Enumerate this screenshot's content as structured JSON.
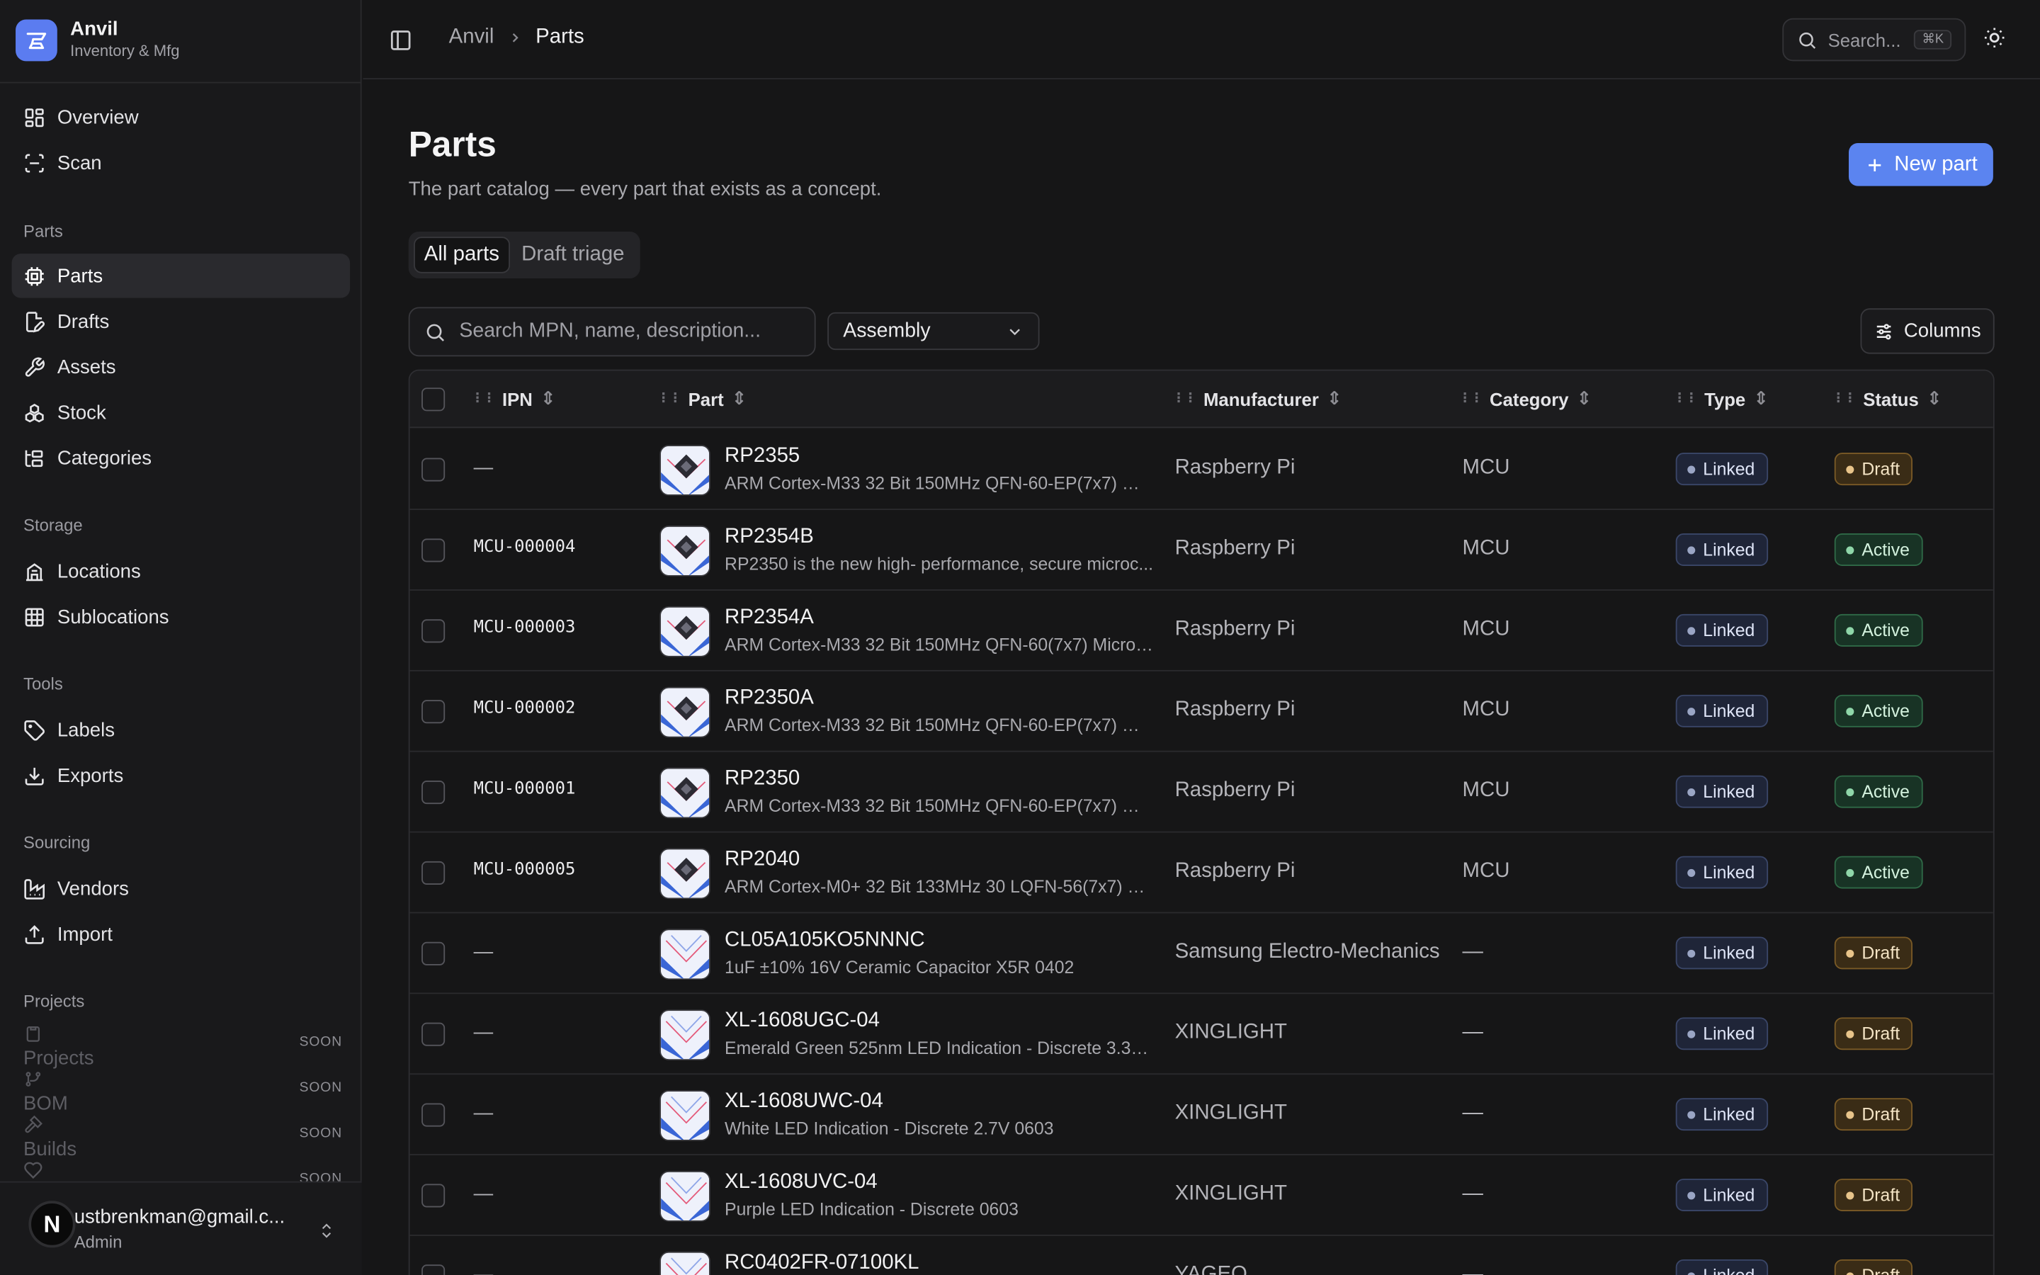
{
  "brand": {
    "name": "Anvil",
    "subtitle": "Inventory & Mfg"
  },
  "sidebar": {
    "top_items": [
      {
        "label": "Overview",
        "icon": "grid-icon"
      },
      {
        "label": "Scan",
        "icon": "scan-icon"
      }
    ],
    "sections": [
      {
        "title": "Parts",
        "items": [
          {
            "label": "Parts",
            "icon": "chip-icon",
            "active": true
          },
          {
            "label": "Drafts",
            "icon": "file-edit-icon"
          },
          {
            "label": "Assets",
            "icon": "wrench-icon"
          },
          {
            "label": "Stock",
            "icon": "boxes-icon"
          },
          {
            "label": "Categories",
            "icon": "tree-icon"
          }
        ]
      },
      {
        "title": "Storage",
        "items": [
          {
            "label": "Locations",
            "icon": "building-icon"
          },
          {
            "label": "Sublocations",
            "icon": "table-grid-icon"
          }
        ]
      },
      {
        "title": "Tools",
        "items": [
          {
            "label": "Labels",
            "icon": "tag-icon"
          },
          {
            "label": "Exports",
            "icon": "download-icon"
          }
        ]
      },
      {
        "title": "Sourcing",
        "items": [
          {
            "label": "Vendors",
            "icon": "factory-icon"
          },
          {
            "label": "Import",
            "icon": "upload-icon"
          }
        ]
      },
      {
        "title": "Projects",
        "items": [
          {
            "label": "Projects",
            "badge": "SOON"
          },
          {
            "label": "BOM",
            "badge": "SOON"
          },
          {
            "label": "Builds",
            "badge": "SOON"
          },
          {
            "label": "",
            "badge": "SOON"
          }
        ]
      }
    ],
    "user": {
      "initial": "N",
      "email": "ustbrenkman@gmail.c...",
      "role": "Admin"
    }
  },
  "topbar": {
    "breadcrumb": [
      "Anvil",
      "Parts"
    ],
    "search_placeholder": "Search...",
    "shortcut": "⌘K"
  },
  "page": {
    "title": "Parts",
    "subtitle": "The part catalog — every part that exists as a concept.",
    "new_button": "New part",
    "tabs": [
      {
        "label": "All parts",
        "active": true
      },
      {
        "label": "Draft triage"
      }
    ],
    "search_placeholder": "Search MPN, name, description...",
    "filter_value": "Assembly",
    "columns_button": "Columns"
  },
  "table": {
    "headers": [
      "IPN",
      "Part",
      "Manufacturer",
      "Category",
      "Type",
      "Status"
    ],
    "rows": [
      {
        "ipn": "—",
        "name": "RP2355",
        "desc": "ARM Cortex-M33 32 Bit 150MHz QFN-60-EP(7x7) Mi...",
        "mfr": "Raspberry Pi",
        "cat": "MCU",
        "type": "Linked",
        "status": "Draft",
        "thumb": "chip"
      },
      {
        "ipn": "MCU-000004",
        "name": "RP2354B",
        "desc": "RP2350 is the new high- performance, secure microc...",
        "mfr": "Raspberry Pi",
        "cat": "MCU",
        "type": "Linked",
        "status": "Active",
        "thumb": "chip"
      },
      {
        "ipn": "MCU-000003",
        "name": "RP2354A",
        "desc": "ARM Cortex-M33 32 Bit 150MHz QFN-60(7x7) Microc...",
        "mfr": "Raspberry Pi",
        "cat": "MCU",
        "type": "Linked",
        "status": "Active",
        "thumb": "chip"
      },
      {
        "ipn": "MCU-000002",
        "name": "RP2350A",
        "desc": "ARM Cortex-M33 32 Bit 150MHz QFN-60-EP(7x7) Mi...",
        "mfr": "Raspberry Pi",
        "cat": "MCU",
        "type": "Linked",
        "status": "Active",
        "thumb": "chip"
      },
      {
        "ipn": "MCU-000001",
        "name": "RP2350",
        "desc": "ARM Cortex-M33 32 Bit 150MHz QFN-60-EP(7x7) Mi...",
        "mfr": "Raspberry Pi",
        "cat": "MCU",
        "type": "Linked",
        "status": "Active",
        "thumb": "chip"
      },
      {
        "ipn": "MCU-000005",
        "name": "RP2040",
        "desc": "ARM Cortex-M0+ 32 Bit 133MHz 30 LQFN-56(7x7) Mi...",
        "mfr": "Raspberry Pi",
        "cat": "MCU",
        "type": "Linked",
        "status": "Active",
        "thumb": "chip"
      },
      {
        "ipn": "—",
        "name": "CL05A105KO5NNNC",
        "desc": "1uF ±10% 16V Ceramic Capacitor X5R 0402",
        "mfr": "Samsung Electro-Mechanics",
        "cat": "—",
        "type": "Linked",
        "status": "Draft",
        "thumb": "plain"
      },
      {
        "ipn": "—",
        "name": "XL-1608UGC-04",
        "desc": "Emerald Green 525nm LED Indication - Discrete 3.3V ...",
        "mfr": "XINGLIGHT",
        "cat": "—",
        "type": "Linked",
        "status": "Draft",
        "thumb": "plain"
      },
      {
        "ipn": "—",
        "name": "XL-1608UWC-04",
        "desc": "White LED Indication - Discrete 2.7V 0603",
        "mfr": "XINGLIGHT",
        "cat": "—",
        "type": "Linked",
        "status": "Draft",
        "thumb": "plain"
      },
      {
        "ipn": "—",
        "name": "XL-1608UVC-04",
        "desc": "Purple LED Indication - Discrete 0603",
        "mfr": "XINGLIGHT",
        "cat": "—",
        "type": "Linked",
        "status": "Draft",
        "thumb": "plain"
      },
      {
        "ipn": "—",
        "name": "RC0402FR-07100KL",
        "desc": "",
        "mfr": "YAGEO",
        "cat": "—",
        "type": "Linked",
        "status": "Draft",
        "thumb": "plain"
      }
    ]
  }
}
